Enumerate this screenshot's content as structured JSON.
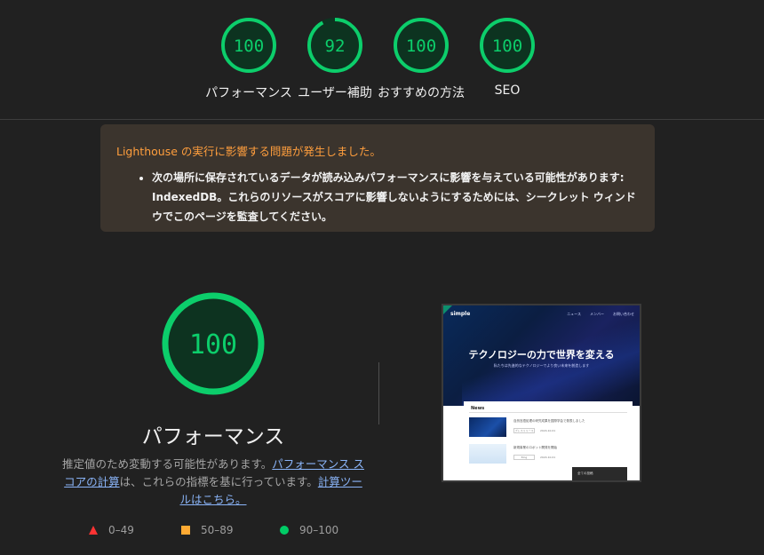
{
  "scores": [
    {
      "value": "100",
      "label": "パフォーマンス",
      "fraction": 1.0
    },
    {
      "value": "92",
      "label": "ユーザー補助",
      "fraction": 0.92
    },
    {
      "value": "100",
      "label": "おすすめの方法",
      "fraction": 1.0
    },
    {
      "value": "100",
      "label": "SEO",
      "fraction": 1.0
    }
  ],
  "warning": {
    "title": "Lighthouse の実行に影響する問題が発生しました。",
    "items": [
      "次の場所に保存されているデータが読み込みパフォーマンスに影響を与えている可能性があります: IndexedDB。これらのリソースがスコアに影響しないようにするためには、シークレット ウィンドウでこのページを監査してください。"
    ]
  },
  "performance": {
    "score": "100",
    "score_fraction": 1.0,
    "title": "パフォーマンス",
    "desc_prefix": "推定値のため変動する可能性があります。",
    "link1": "パフォーマンス スコアの計算",
    "desc_middle": "は、これらの指標を基に行っています。",
    "link2": "計算ツールはこちら。"
  },
  "legend": [
    {
      "range": "0–49",
      "icon": "triangle-icon",
      "color": "#ff3333"
    },
    {
      "range": "50–89",
      "icon": "square-icon",
      "color": "#ffaa33"
    },
    {
      "range": "90–100",
      "icon": "circle-icon",
      "color": "#00cc66"
    }
  ],
  "colors": {
    "pass": "#0cce6b",
    "pass_bg": "#0d3320",
    "warning_bg": "#3b342d",
    "warning_title": "#ff9e3d"
  },
  "thumbnail": {
    "logo": "simple",
    "nav": [
      "ニュース",
      "メンバー",
      "お問い合わせ"
    ],
    "headline": "テクノロジーの力で世界を変える",
    "subheadline": "私たちは先進的なテクノロジーでより良い未来を創造します",
    "news_title": "News",
    "news": [
      {
        "text": "自然言語処理の研究成果を国際学会で発表しました",
        "tag": "プレスリリース",
        "date": "2024.10.01"
      },
      {
        "text": "新規事業のロボット開発を開始",
        "tag": "Blog",
        "date": "2024.10.01"
      }
    ],
    "button": "全ての投稿"
  }
}
